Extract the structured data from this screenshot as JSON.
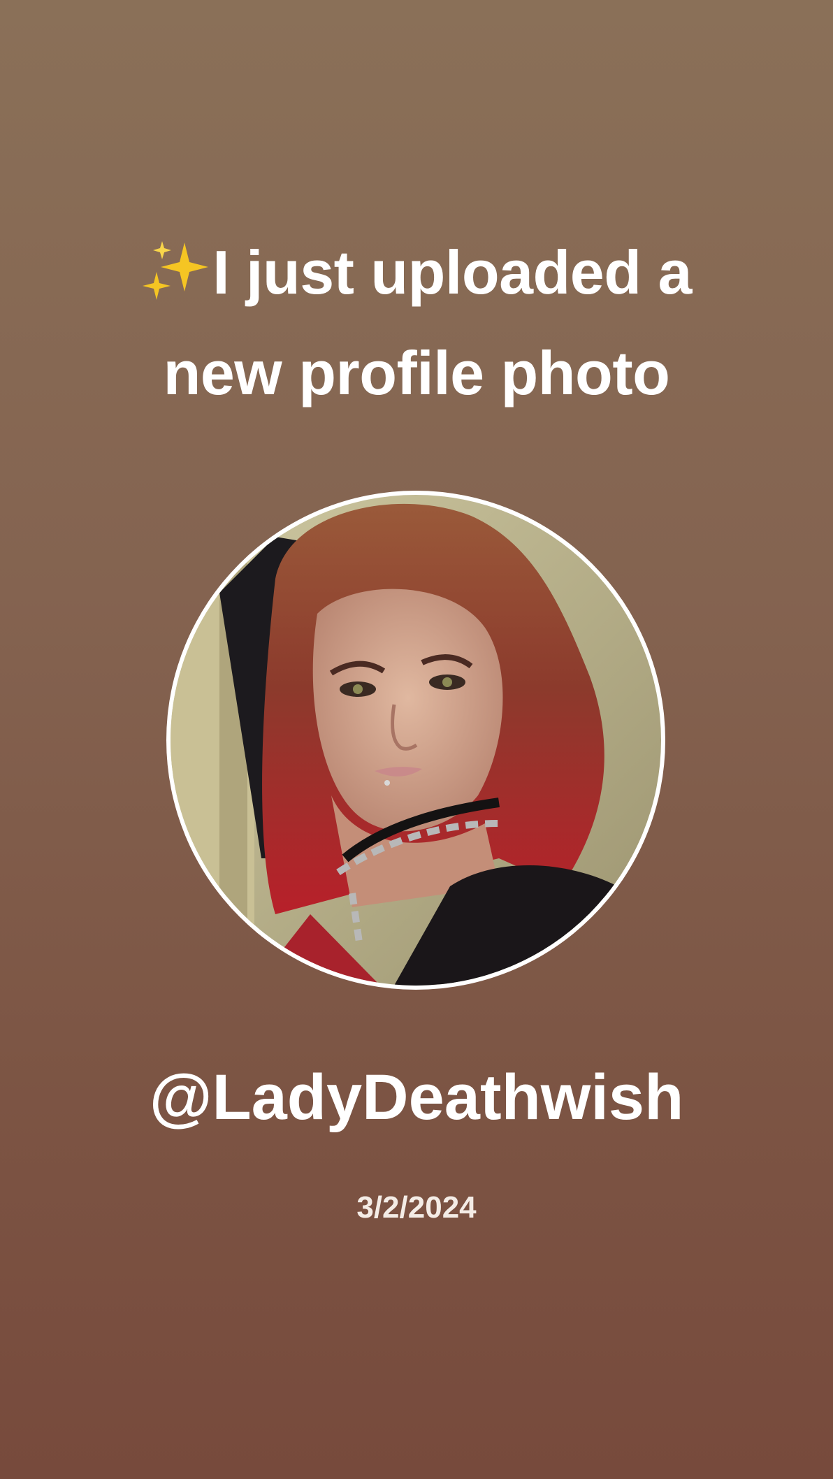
{
  "headline": {
    "line1": "I just uploaded a",
    "line2": "new profile photo",
    "sparkle_icon": "sparkles-icon"
  },
  "profile": {
    "username": "@LadyDeathwish",
    "date": "3/2/2024",
    "photo_icon": "profile-photo"
  },
  "colors": {
    "background_top": "#8a7058",
    "background_bottom": "#774a3c",
    "text": "#ffffff",
    "avatar_ring": "#ffffff",
    "sparkle": "#f5c523"
  }
}
